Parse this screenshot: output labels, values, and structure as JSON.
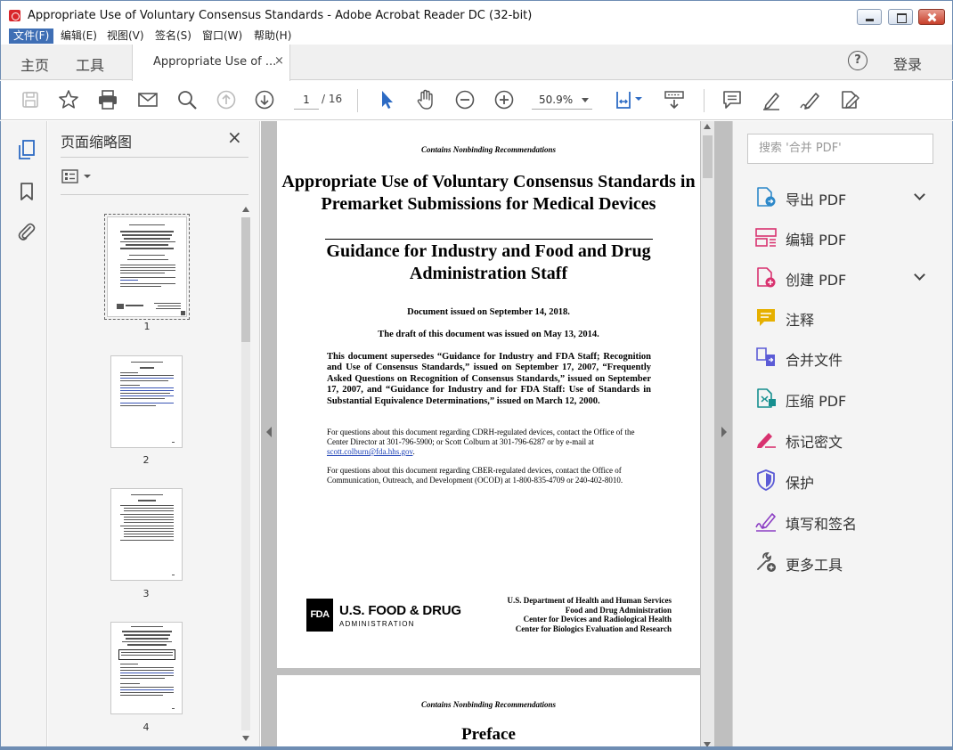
{
  "window": {
    "title": "Appropriate Use of Voluntary Consensus Standards - Adobe Acrobat Reader DC (32-bit)"
  },
  "menu": [
    "文件(F)",
    "编辑(E)",
    "视图(V)",
    "签名(S)",
    "窗口(W)",
    "帮助(H)"
  ],
  "tabs": {
    "home": "主页",
    "tools": "工具",
    "document": "Appropriate Use of ...",
    "document_close": "×",
    "help": "?",
    "login": "登录"
  },
  "toolbar": {
    "current_page": "1",
    "page_total": "/ 16",
    "zoom": "50.9%"
  },
  "thumbnails": {
    "title": "页面缩略图",
    "close": "×",
    "pages": [
      "1",
      "2",
      "3",
      "4"
    ],
    "selected_page": 1
  },
  "document": {
    "page1": {
      "header": "Contains Nonbinding Recommendations",
      "title": "Appropriate Use of Voluntary Consensus Standards in Premarket Submissions for Medical Devices",
      "subtitle": "Guidance for Industry and Food and Drug Administration Staff",
      "issued": "Document issued on September 14, 2018.",
      "draft": "The draft of this document was issued on May 13, 2014.",
      "supersedes": "This document supersedes “Guidance for Industry and FDA Staff; Recognition and Use of Consensus Standards,” issued on September 17, 2007, “Frequently Asked Questions on Recognition of Consensus Standards,” issued on September 17, 2007, and “Guidance for Industry and for FDA Staff: Use of Standards in Substantial Equivalence Determinations,” issued on March 12, 2000.",
      "cdrh_contact": "For questions about this document regarding CDRH-regulated devices, contact the Office of the Center Director at 301-796-5900; or Scott Colburn at 301-796-6287 or by e-mail at",
      "cdrh_email": "scott.colburn@fda.hhs.gov",
      "cdrh_end": ".",
      "cber_contact": "For questions about this document regarding CBER-regulated devices, contact the Office of Communication, Outreach, and Development (OCOD) at 1-800-835-4709 or 240-402-8010.",
      "fda_logo": "FDA",
      "fda_name": "U.S. FOOD & DRUG",
      "fda_admin": "ADMINISTRATION",
      "hhs": [
        "U.S. Department of Health and Human Services",
        "Food and Drug Administration",
        "Center for Devices and Radiological Health",
        "Center for Biologics Evaluation and Research"
      ]
    },
    "page2": {
      "header": "Contains Nonbinding Recommendations",
      "title": "Preface"
    }
  },
  "tools_pane": {
    "search_placeholder": "搜索 '合并 PDF'",
    "items": [
      {
        "label": "导出 PDF",
        "icon": "export-pdf-icon",
        "color": "#2d88c9",
        "expandable": true
      },
      {
        "label": "编辑 PDF",
        "icon": "edit-pdf-icon",
        "color": "#d8326f",
        "expandable": false
      },
      {
        "label": "创建 PDF",
        "icon": "create-pdf-icon",
        "color": "#d8326f",
        "expandable": true
      },
      {
        "label": "注释",
        "icon": "comment-icon",
        "color": "#e6b000",
        "expandable": false
      },
      {
        "label": "合并文件",
        "icon": "combine-files-icon",
        "color": "#5b5bd6",
        "expandable": false
      },
      {
        "label": "压缩 PDF",
        "icon": "compress-pdf-icon",
        "color": "#168f8f",
        "expandable": false
      },
      {
        "label": "标记密文",
        "icon": "redact-icon",
        "color": "#d8326f",
        "expandable": false
      },
      {
        "label": "保护",
        "icon": "protect-icon",
        "color": "#5b5bd6",
        "expandable": false
      },
      {
        "label": "填写和签名",
        "icon": "fill-sign-icon",
        "color": "#8c3fc4",
        "expandable": false
      },
      {
        "label": "更多工具",
        "icon": "more-tools-icon",
        "color": "#555555",
        "expandable": false
      }
    ]
  },
  "colors": {
    "menu_active": "#3f6fb5",
    "accent_blue": "#2d6bc4"
  }
}
